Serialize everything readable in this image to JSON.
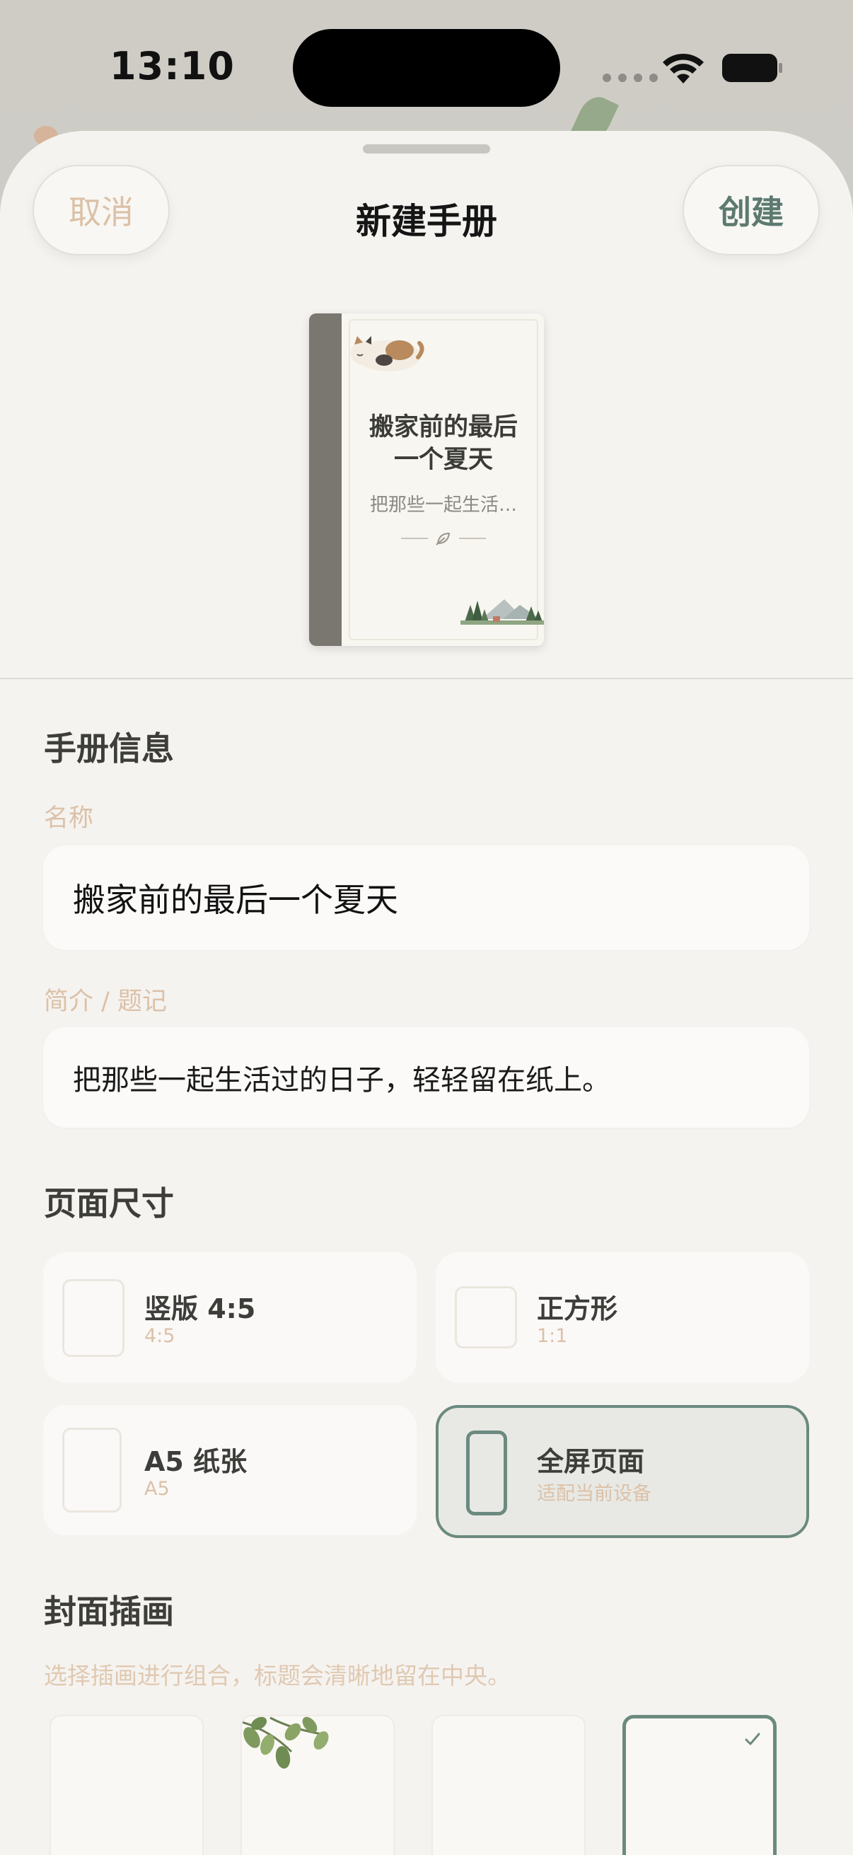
{
  "status_bar": {
    "time": "13:10"
  },
  "header": {
    "cancel_label": "取消",
    "title": "新建手册",
    "create_label": "创建"
  },
  "cover_preview": {
    "title_line1": "搬家前的最后",
    "title_line2": "一个夏天",
    "subtitle": "把那些一起生活…",
    "spine_color": "#7a7670"
  },
  "info_section": {
    "title": "手册信息",
    "name_label": "名称",
    "name_value": "搬家前的最后一个夏天",
    "intro_label": "简介 / 题记",
    "intro_value": "把那些一起生活过的日子，轻轻留在纸上。"
  },
  "size_section": {
    "title": "页面尺寸",
    "options": [
      {
        "name": "竖版 4:5",
        "sub": "4:5",
        "selected": false
      },
      {
        "name": "正方形",
        "sub": "1:1",
        "selected": false
      },
      {
        "name": "A5 纸张",
        "sub": "A5",
        "selected": false
      },
      {
        "name": "全屏页面",
        "sub": "适配当前设备",
        "selected": true
      }
    ]
  },
  "illustration_section": {
    "title": "封面插画",
    "hint": "选择插画进行组合，标题会清晰地留在中央。",
    "items": [
      {
        "icon": "blank-illustration",
        "selected": false
      },
      {
        "icon": "leaves-illustration",
        "selected": false
      },
      {
        "icon": "sprout-illustration",
        "selected": false
      },
      {
        "icon": "blank-illustration",
        "selected": true
      }
    ]
  },
  "colors": {
    "accent": "#6b8a80",
    "label_tan": "#dcc1a7",
    "sheet_bg": "#f5f3f0"
  }
}
